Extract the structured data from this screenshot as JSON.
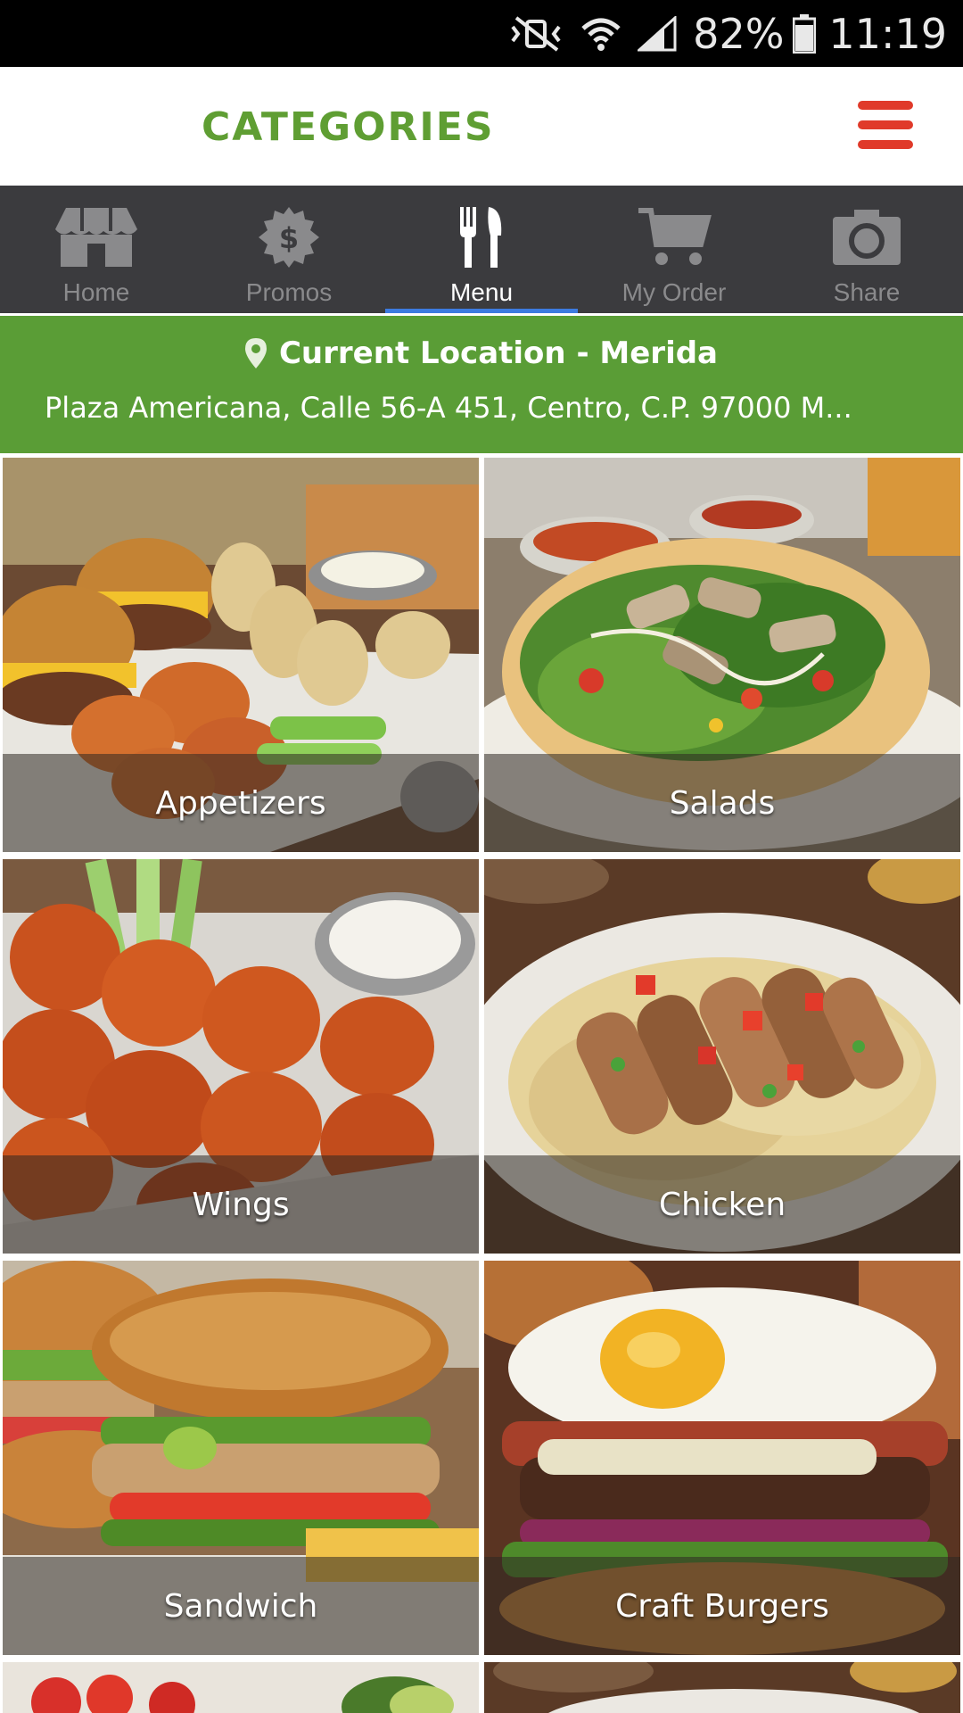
{
  "status_bar": {
    "battery_percent": "82%",
    "time": "11:19",
    "icons": [
      "vibrate-mute-icon",
      "wifi-icon",
      "signal-icon",
      "battery-icon"
    ]
  },
  "header": {
    "title": "CATEGORIES",
    "title_color": "#5f9e33",
    "menu_icon": "hamburger-menu-icon",
    "menu_color": "#e03a2a"
  },
  "tabs": [
    {
      "label": "Home",
      "icon": "storefront-icon",
      "active": false
    },
    {
      "label": "Promos",
      "icon": "promo-badge-icon",
      "active": false
    },
    {
      "label": "Menu",
      "icon": "fork-knife-icon",
      "active": true
    },
    {
      "label": "My Order",
      "icon": "cart-icon",
      "active": false
    },
    {
      "label": "Share",
      "icon": "camera-icon",
      "active": false
    }
  ],
  "location": {
    "icon": "map-pin-icon",
    "title": "Current Location - Merida",
    "address": "Plaza Americana, Calle 56-A 451, Centro, C.P. 97000 M...",
    "background": "#5a9d36"
  },
  "categories": [
    {
      "label": "Appetizers",
      "theme": "appetizers"
    },
    {
      "label": "Salads",
      "theme": "salads"
    },
    {
      "label": "Wings",
      "theme": "wings"
    },
    {
      "label": "Chicken",
      "theme": "chicken"
    },
    {
      "label": "Sandwich",
      "theme": "sandwich"
    },
    {
      "label": "Craft Burgers",
      "theme": "burgers"
    },
    {
      "label": "",
      "theme": "partial-left"
    },
    {
      "label": "",
      "theme": "partial-right"
    }
  ]
}
